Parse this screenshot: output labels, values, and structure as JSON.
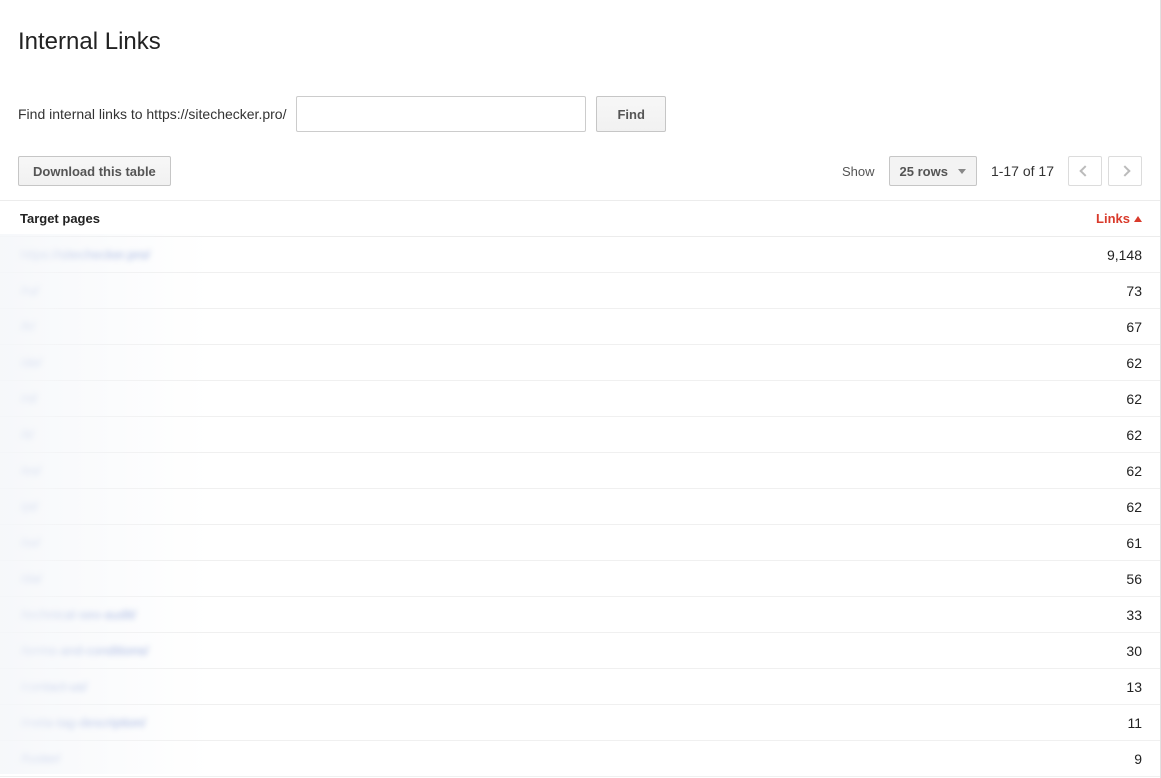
{
  "title": "Internal Links",
  "search": {
    "label": "Find internal links to https://sitechecker.pro/",
    "value": "",
    "button": "Find"
  },
  "toolbar": {
    "download": "Download this table",
    "show_label": "Show",
    "rows_option": "25 rows",
    "pager_text": "1-17 of 17"
  },
  "table": {
    "col_target": "Target pages",
    "col_links": "Links",
    "rows": [
      {
        "target": "https://sitechecker.pro/",
        "links": "9,148"
      },
      {
        "target": "/ru/",
        "links": "73"
      },
      {
        "target": "/fr/",
        "links": "67"
      },
      {
        "target": "/de/",
        "links": "62"
      },
      {
        "target": "/nl/",
        "links": "62"
      },
      {
        "target": "/it/",
        "links": "62"
      },
      {
        "target": "/es/",
        "links": "62"
      },
      {
        "target": "/pt/",
        "links": "62"
      },
      {
        "target": "/sv/",
        "links": "61"
      },
      {
        "target": "/da/",
        "links": "56"
      },
      {
        "target": "/technical-seo-audit/",
        "links": "33"
      },
      {
        "target": "/terms-and-conditions/",
        "links": "30"
      },
      {
        "target": "/contact-us/",
        "links": "13"
      },
      {
        "target": "/meta-tag-description/",
        "links": "11"
      },
      {
        "target": "/footer/",
        "links": "9"
      }
    ]
  }
}
